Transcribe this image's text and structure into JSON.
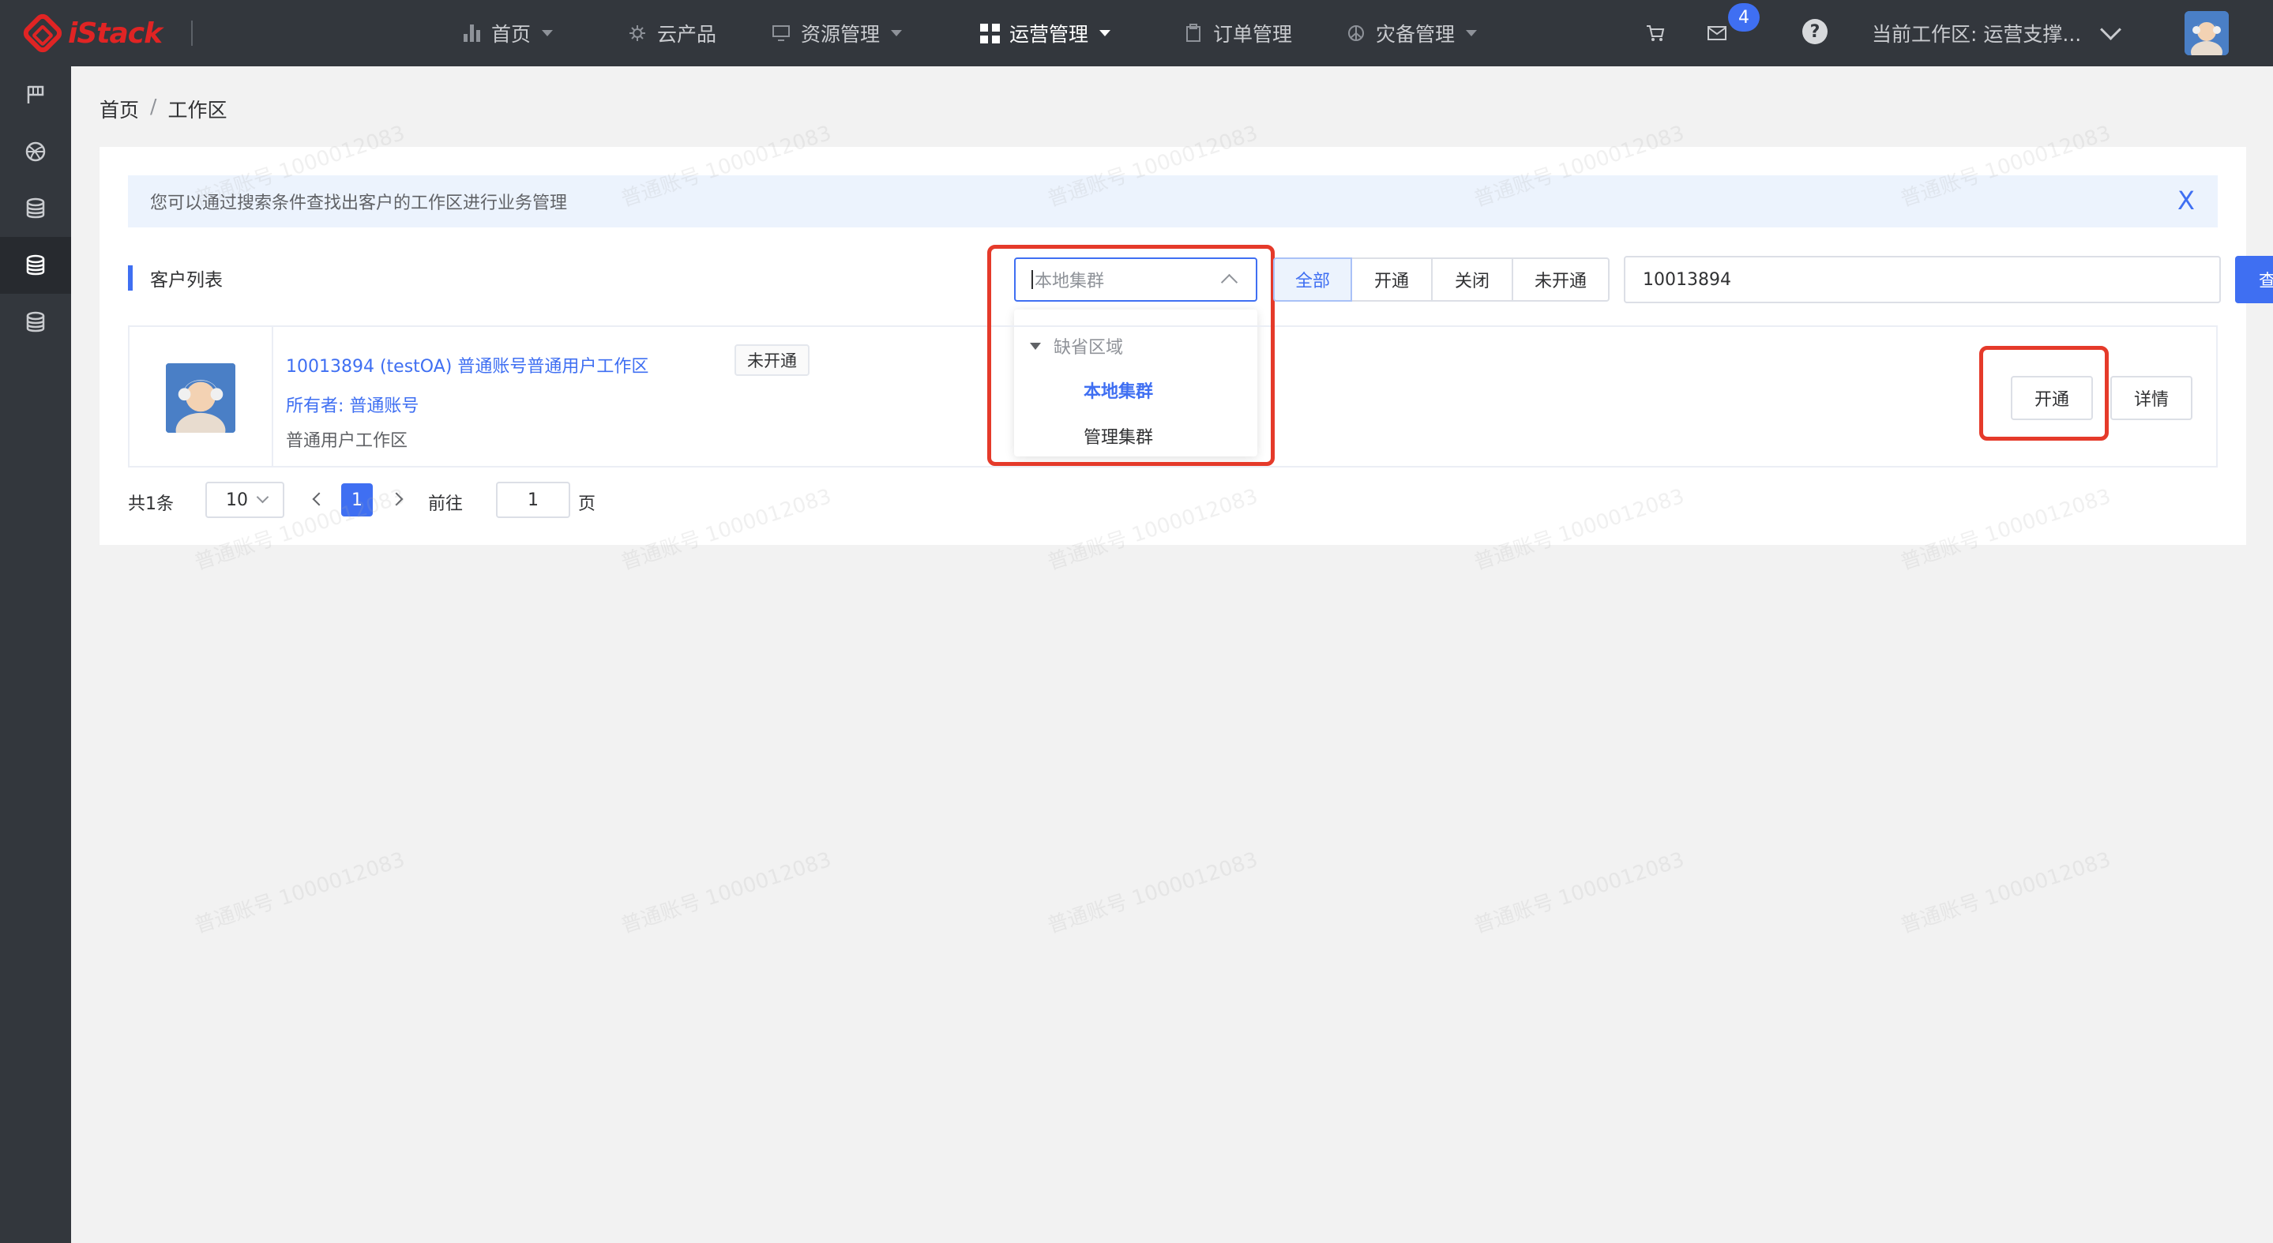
{
  "app": {
    "logo_text": "iStack"
  },
  "nav": {
    "items": [
      {
        "label": "首页",
        "icon": "bar-chart-icon",
        "has_caret": true,
        "active": false
      },
      {
        "label": "云产品",
        "icon": "gear-icon",
        "has_caret": false,
        "active": false
      },
      {
        "label": "资源管理",
        "icon": "monitor-icon",
        "has_caret": true,
        "active": false
      },
      {
        "label": "运营管理",
        "icon": "grid-icon",
        "has_caret": true,
        "active": true
      },
      {
        "label": "订单管理",
        "icon": "clipboard-icon",
        "has_caret": false,
        "active": false
      },
      {
        "label": "灾备管理",
        "icon": "shield-icon",
        "has_caret": true,
        "active": false
      }
    ]
  },
  "topright": {
    "mail_badge": "4",
    "help_symbol": "?",
    "workspace_label": "当前工作区: 运营支撑..."
  },
  "sidebar": {
    "items": [
      {
        "icon": "flag-icon",
        "active": false
      },
      {
        "icon": "basketball-icon",
        "active": false
      },
      {
        "icon": "database-icon",
        "active": false
      },
      {
        "icon": "database-icon",
        "active": true
      },
      {
        "icon": "database-icon",
        "active": false
      }
    ]
  },
  "breadcrumb": {
    "home": "首页",
    "separator": "/",
    "current": "工作区"
  },
  "alert": {
    "text": "您可以通过搜索条件查找出客户的工作区进行业务管理",
    "close_symbol": "X"
  },
  "list": {
    "title": "客户列表"
  },
  "filters": {
    "cluster_placeholder": "本地集群",
    "dropdown": {
      "group": "缺省区域",
      "options": [
        {
          "label": "本地集群",
          "selected": true
        },
        {
          "label": "管理集群",
          "selected": false
        }
      ]
    },
    "status_tabs": [
      {
        "label": "全部",
        "active": true
      },
      {
        "label": "开通",
        "active": false
      },
      {
        "label": "关闭",
        "active": false
      },
      {
        "label": "未开通",
        "active": false
      }
    ],
    "search_value": "10013894",
    "query_label": "查询"
  },
  "row": {
    "name": "10013894 (testOA) 普通账号普通用户工作区",
    "status_tag": "未开通",
    "owner": "所有者: 普通账号",
    "description": "普通用户工作区",
    "actions": {
      "open": "开通",
      "detail": "详情"
    }
  },
  "pagination": {
    "total": "共1条",
    "page_size": "10",
    "current_page": "1",
    "goto_label": "前往",
    "goto_value": "1",
    "page_unit": "页"
  },
  "watermark": "普通账号 1000012083",
  "colors": {
    "topbar": "#33373d",
    "accent": "#3f6ff2",
    "annotation": "#e53a2a"
  }
}
